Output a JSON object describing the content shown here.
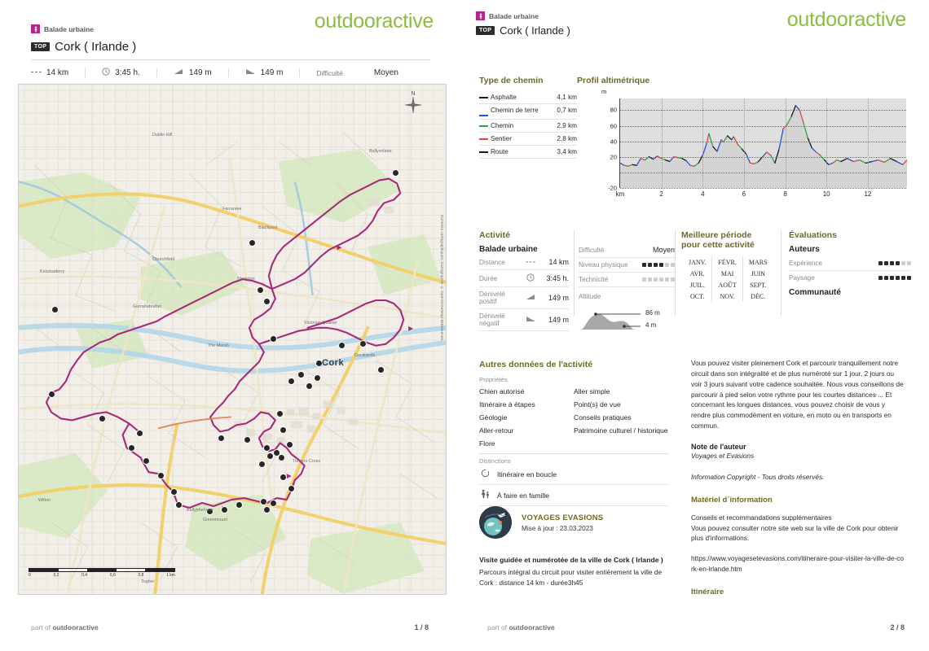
{
  "brand": "outdooractive",
  "header": {
    "category_label": "Balade urbaine",
    "category_icon": "walking-person-icon",
    "top_badge": "TOP",
    "title": "Cork ( Irlande )"
  },
  "stats": [
    {
      "icon": "distance-icon",
      "value": "14 km"
    },
    {
      "icon": "clock-icon",
      "value": "3:45 h."
    },
    {
      "icon": "ascent-icon",
      "value": "149 m"
    },
    {
      "icon": "descent-icon",
      "value": "149 m"
    }
  ],
  "difficulty": {
    "label": "Difficulté",
    "value": "Moyen"
  },
  "map": {
    "city_label": "Cork",
    "compass": "N",
    "scale_labels": [
      "0",
      "0,2",
      "0,4",
      "0,6",
      "0,8",
      "1 km"
    ],
    "attribution": "Données cartographiques: Cartographie © OpenStreetMap-Mitwirkende",
    "places": [
      "Dublin Hill",
      "Ballyvolane",
      "Churchfield",
      "Knockaderry",
      "Gurranabraher",
      "Farranree",
      "Blackpool",
      "Shandon",
      "The Marsh",
      "Victorian Quarter",
      "Docklands",
      "Greenmount",
      "Turners Cross",
      "Ballyphehane",
      "Togher",
      "Wilton"
    ],
    "route_color": "#a62a7b",
    "waypoint_count": 35
  },
  "path_types": {
    "title": "Type de chemin",
    "rows": [
      {
        "label": "Asphalte",
        "value": "4,1 km",
        "color": "#1a1a1a"
      },
      {
        "label": "Chemin de terre",
        "value": "0,7 km",
        "color": "#2a4fd6"
      },
      {
        "label": "Chemin",
        "value": "2,9 km",
        "color": "#2fa34a"
      },
      {
        "label": "Sentier",
        "value": "2,8 km",
        "color": "#e8443f"
      },
      {
        "label": "Route",
        "value": "3,4 km",
        "color": "#1a1a1a"
      }
    ]
  },
  "chart_data": {
    "type": "area",
    "title": "Profil altimétrique",
    "xlabel": "km",
    "ylabel": "m",
    "ylim": [
      -20,
      95
    ],
    "xlim": [
      0,
      13.9
    ],
    "yticks": [
      -20,
      0,
      20,
      40,
      60,
      80
    ],
    "ytick_labels": [
      "-20",
      "",
      "20",
      "40",
      "60",
      "80"
    ],
    "xticks": [
      0,
      2,
      4,
      6,
      8,
      10,
      12
    ],
    "xtick_labels": [
      "km",
      "2",
      "4",
      "6",
      "8",
      "10",
      "12"
    ],
    "grid": true,
    "legend": "none",
    "fill_color": "#d4d4d4",
    "series": [
      {
        "name": "Altitude",
        "x": [
          0.0,
          0.2,
          0.4,
          0.6,
          0.8,
          1.0,
          1.2,
          1.4,
          1.6,
          1.8,
          2.0,
          2.2,
          2.4,
          2.6,
          2.8,
          3.0,
          3.2,
          3.4,
          3.6,
          3.8,
          4.0,
          4.2,
          4.3,
          4.5,
          4.7,
          4.9,
          5.0,
          5.2,
          5.4,
          5.5,
          5.7,
          5.9,
          6.1,
          6.3,
          6.5,
          6.7,
          6.9,
          7.1,
          7.3,
          7.5,
          7.7,
          7.9,
          8.1,
          8.3,
          8.5,
          8.7,
          8.9,
          9.1,
          9.3,
          9.5,
          9.7,
          9.9,
          10.1,
          10.3,
          10.5,
          10.7,
          11.0,
          11.3,
          11.6,
          11.9,
          12.2,
          12.5,
          12.8,
          13.1,
          13.4,
          13.7,
          13.9
        ],
        "values": [
          12,
          9,
          8,
          10,
          9,
          18,
          16,
          20,
          17,
          21,
          18,
          16,
          14,
          20,
          19,
          18,
          15,
          9,
          8,
          12,
          22,
          38,
          50,
          33,
          27,
          42,
          39,
          47,
          42,
          46,
          36,
          30,
          24,
          12,
          11,
          14,
          20,
          26,
          22,
          12,
          30,
          56,
          62,
          72,
          86,
          80,
          62,
          44,
          31,
          26,
          22,
          16,
          10,
          12,
          16,
          14,
          18,
          14,
          16,
          12,
          14,
          16,
          13,
          18,
          14,
          10,
          16
        ]
      }
    ],
    "segment_colors": [
      "#1a1a1a",
      "#2fa34a",
      "#e8443f",
      "#2a4fd6"
    ]
  },
  "activity": {
    "title": "Activité",
    "type": "Balade urbaine",
    "rows": [
      {
        "label": "Distance",
        "icon": "distance-icon",
        "value": "14 km"
      },
      {
        "label": "Durée",
        "icon": "clock-icon",
        "value": "3:45 h."
      },
      {
        "label": "Dénivelé positif",
        "icon": "ascent-icon",
        "value": "149 m"
      },
      {
        "label": "Dénivelé négatif",
        "icon": "descent-icon",
        "value": "149 m"
      }
    ],
    "ratings": [
      {
        "label": "Difficulté",
        "value": "Moyen"
      },
      {
        "label": "Niveau physique",
        "filled": 4,
        "total": 6
      },
      {
        "label": "Technicité",
        "filled": 0,
        "total": 6
      }
    ],
    "altitude": {
      "label": "Altitude",
      "max": "86 m",
      "min": "4 m"
    }
  },
  "best_period": {
    "title_line1": "Meilleure période",
    "title_line2": "pour cette activité",
    "months": [
      [
        "JANV.",
        "FÉVR.",
        "MARS"
      ],
      [
        "AVR.",
        "MAI",
        "JUIN"
      ],
      [
        "JUIL.",
        "AOÛT",
        "SEPT."
      ],
      [
        "OCT.",
        "NOV.",
        "DÉC."
      ]
    ]
  },
  "evaluations": {
    "title": "Évaluations",
    "authors_label": "Auteurs",
    "rows": [
      {
        "label": "Expérience",
        "filled": 4,
        "total": 6
      },
      {
        "label": "Paysage",
        "filled": 6,
        "total": 6
      }
    ],
    "community_label": "Communauté"
  },
  "other_data": {
    "title": "Autres données de l'activité",
    "properties_label": "Propriétés",
    "properties": [
      [
        "Chien autorisé",
        "Aller simple"
      ],
      [
        "Itinéraire à étapes",
        "Point(s) de vue"
      ],
      [
        "Géologie",
        "Conseils pratiques"
      ],
      [
        "Aller-retour",
        "Patrimoine culturel / historique"
      ],
      [
        "Flore",
        ""
      ]
    ],
    "distinctions_label": "Distinctions",
    "distinctions": [
      {
        "icon": "loop-route-icon",
        "label": "Itinéraire en boucle"
      },
      {
        "icon": "family-icon",
        "label": "À faire en famille"
      }
    ]
  },
  "organisation": {
    "logo_icon": "globe-plane-icon",
    "name": "VOYAGES EVASIONS",
    "updated": "Mise à jour : 23.03.2023"
  },
  "summary": {
    "heading": "Visite guidée et numérotée de la ville de Cork ( Irlande )",
    "text": "Parcours intégral du circuit pour visiter entièrement la ville de Cork : distance 14 km - durée3h45"
  },
  "description": {
    "paragraph": "Vous pouvez visiter pleinement Cork et parcourir tranquillement notre circuit dans son intégralité et de plus numéroté sur 1 jour, 2 jours ou voir 3 jours suivant votre cadence souhaitée. Nous vous conseillons de parcourir à pied selon votre rythme pour les courtes distances ... Et concernant les longues distances, vous pouvez choisir de vous y rendre plus commodément en voiture, en moto ou en transports en commun.",
    "author_note_label": "Note de l'auteur",
    "author_note_value": "Voyages et Evasions",
    "copyright": "Information Copyright - Tous droits réservés."
  },
  "material": {
    "title": "Matériel d´information",
    "line1": "Conseils et recommandations supplémentaires",
    "line2": "Vous pouvez consulter notre site web sur la ville de Cork pour obtenir plus d'informations.",
    "url": "https://www.voyagesetevasions.com/itineraire-pour-visiter-la-ville-de-cork-en-irlande.htm",
    "itinerary_title": "Itinéraire"
  },
  "footer": {
    "part_of": "part of ",
    "brand": "outdooractive",
    "page_left": "1 / 8",
    "page_right": "2 / 8"
  }
}
